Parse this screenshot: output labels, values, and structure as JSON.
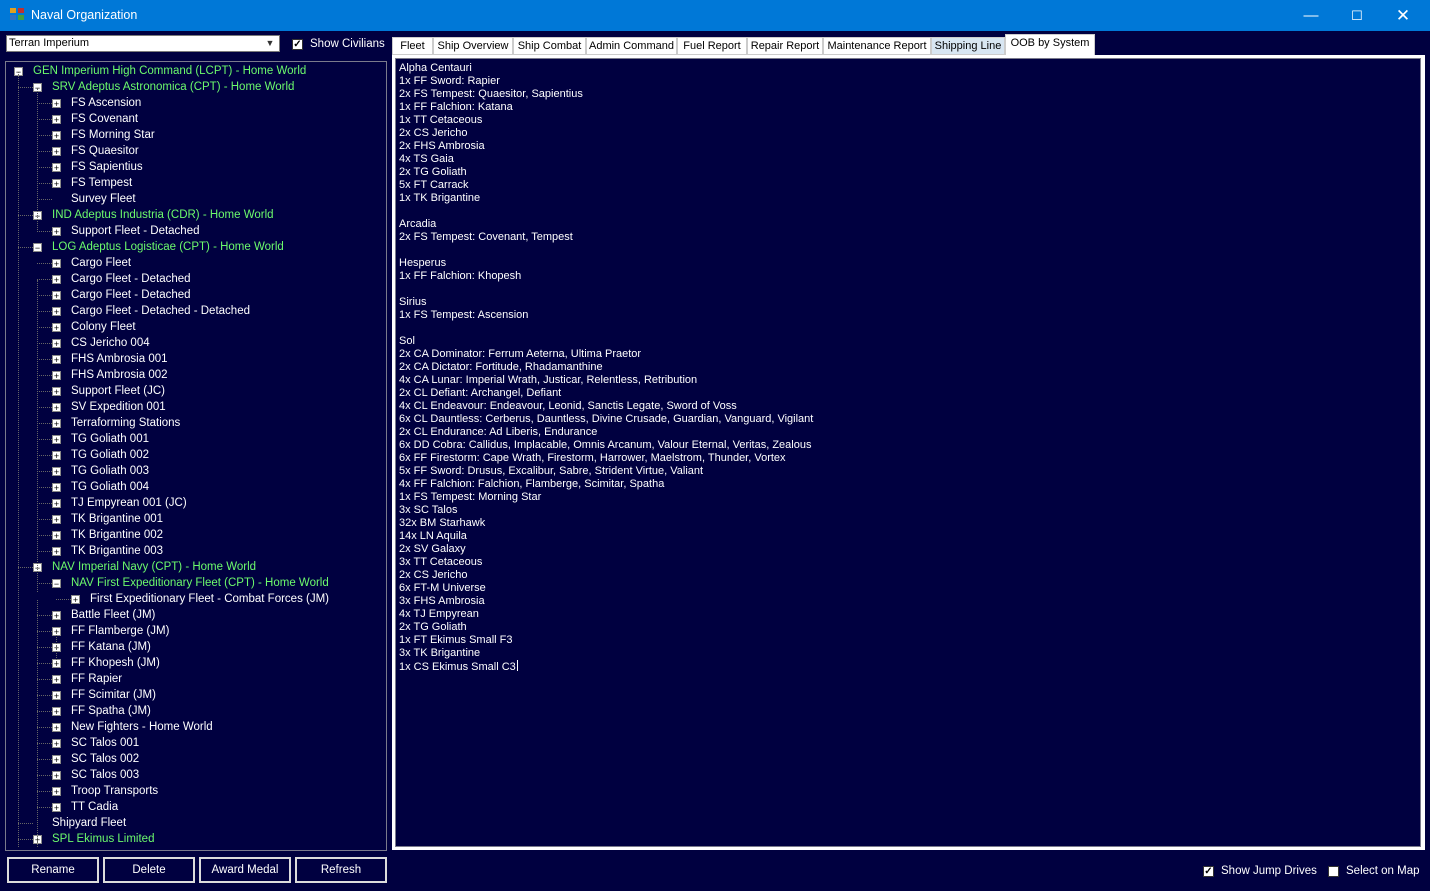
{
  "window": {
    "title": "Naval Organization",
    "minimize": "—",
    "maximize": "☐",
    "close": "✕"
  },
  "race_selector": {
    "value": "Terran Imperium",
    "arrow": "▼"
  },
  "show_civilians": {
    "label": "Show Civilians",
    "checked": true
  },
  "tree": [
    {
      "text": "GEN Imperium High Command  (LCPT)  -  Home World",
      "depth": 0,
      "color": "green",
      "exp": "minus"
    },
    {
      "text": "SRV Adeptus Astronomica  (CPT)  -  Home World",
      "depth": 1,
      "color": "green",
      "exp": "minus"
    },
    {
      "text": "FS Ascension",
      "depth": 2,
      "color": "white",
      "exp": "plus"
    },
    {
      "text": "FS Covenant",
      "depth": 2,
      "color": "white",
      "exp": "plus"
    },
    {
      "text": "FS Morning Star",
      "depth": 2,
      "color": "white",
      "exp": "plus"
    },
    {
      "text": "FS Quaesitor",
      "depth": 2,
      "color": "white",
      "exp": "plus"
    },
    {
      "text": "FS Sapientius",
      "depth": 2,
      "color": "white",
      "exp": "plus"
    },
    {
      "text": "FS Tempest",
      "depth": 2,
      "color": "white",
      "exp": "plus"
    },
    {
      "text": "Survey Fleet",
      "depth": 2,
      "color": "white",
      "exp": "none"
    },
    {
      "text": "IND Adeptus Industria  (CDR)  -  Home World",
      "depth": 1,
      "color": "green",
      "exp": "minus"
    },
    {
      "text": "Support Fleet - Detached",
      "depth": 2,
      "color": "white",
      "exp": "plus"
    },
    {
      "text": "LOG Adeptus Logisticae  (CPT)  -  Home World",
      "depth": 1,
      "color": "green",
      "exp": "minus"
    },
    {
      "text": "Cargo Fleet",
      "depth": 2,
      "color": "white",
      "exp": "plus"
    },
    {
      "text": "Cargo Fleet - Detached",
      "depth": 2,
      "color": "white",
      "exp": "plus"
    },
    {
      "text": "Cargo Fleet - Detached",
      "depth": 2,
      "color": "white",
      "exp": "plus"
    },
    {
      "text": "Cargo Fleet - Detached - Detached",
      "depth": 2,
      "color": "white",
      "exp": "plus"
    },
    {
      "text": "Colony Fleet",
      "depth": 2,
      "color": "white",
      "exp": "plus"
    },
    {
      "text": "CS Jericho 004",
      "depth": 2,
      "color": "white",
      "exp": "plus"
    },
    {
      "text": "FHS Ambrosia 001",
      "depth": 2,
      "color": "white",
      "exp": "plus"
    },
    {
      "text": "FHS Ambrosia 002",
      "depth": 2,
      "color": "white",
      "exp": "plus"
    },
    {
      "text": "Support Fleet  (JC)",
      "depth": 2,
      "color": "white",
      "exp": "plus"
    },
    {
      "text": "SV Expedition 001",
      "depth": 2,
      "color": "white",
      "exp": "plus"
    },
    {
      "text": "Terraforming Stations",
      "depth": 2,
      "color": "white",
      "exp": "plus"
    },
    {
      "text": "TG Goliath 001",
      "depth": 2,
      "color": "white",
      "exp": "plus"
    },
    {
      "text": "TG Goliath 002",
      "depth": 2,
      "color": "white",
      "exp": "plus"
    },
    {
      "text": "TG Goliath 003",
      "depth": 2,
      "color": "white",
      "exp": "plus"
    },
    {
      "text": "TG Goliath 004",
      "depth": 2,
      "color": "white",
      "exp": "plus"
    },
    {
      "text": "TJ Empyrean 001  (JC)",
      "depth": 2,
      "color": "white",
      "exp": "plus"
    },
    {
      "text": "TK Brigantine 001",
      "depth": 2,
      "color": "white",
      "exp": "plus"
    },
    {
      "text": "TK Brigantine 002",
      "depth": 2,
      "color": "white",
      "exp": "plus"
    },
    {
      "text": "TK Brigantine 003",
      "depth": 2,
      "color": "white",
      "exp": "plus"
    },
    {
      "text": "NAV Imperial Navy  (CPT)  -  Home World",
      "depth": 1,
      "color": "green",
      "exp": "minus"
    },
    {
      "text": "NAV First Expeditionary Fleet  (CPT)  -  Home World",
      "depth": 2,
      "color": "green",
      "exp": "minus"
    },
    {
      "text": "First Expeditionary Fleet - Combat Forces  (JM)",
      "depth": 3,
      "color": "white",
      "exp": "plus"
    },
    {
      "text": "Battle Fleet  (JM)",
      "depth": 2,
      "color": "white",
      "exp": "plus"
    },
    {
      "text": "FF Flamberge  (JM)",
      "depth": 2,
      "color": "white",
      "exp": "plus"
    },
    {
      "text": "FF Katana  (JM)",
      "depth": 2,
      "color": "white",
      "exp": "plus"
    },
    {
      "text": "FF Khopesh  (JM)",
      "depth": 2,
      "color": "white",
      "exp": "plus"
    },
    {
      "text": "FF Rapier",
      "depth": 2,
      "color": "white",
      "exp": "plus"
    },
    {
      "text": "FF Scimitar  (JM)",
      "depth": 2,
      "color": "white",
      "exp": "plus"
    },
    {
      "text": "FF Spatha  (JM)",
      "depth": 2,
      "color": "white",
      "exp": "plus"
    },
    {
      "text": "New Fighters - Home World",
      "depth": 2,
      "color": "white",
      "exp": "plus"
    },
    {
      "text": "SC Talos 001",
      "depth": 2,
      "color": "white",
      "exp": "plus"
    },
    {
      "text": "SC Talos 002",
      "depth": 2,
      "color": "white",
      "exp": "plus"
    },
    {
      "text": "SC Talos 003",
      "depth": 2,
      "color": "white",
      "exp": "plus"
    },
    {
      "text": "Troop Transports",
      "depth": 2,
      "color": "white",
      "exp": "plus"
    },
    {
      "text": "TT Cadia",
      "depth": 2,
      "color": "white",
      "exp": "plus"
    },
    {
      "text": "Shipyard Fleet",
      "depth": 1,
      "color": "white",
      "exp": "none"
    },
    {
      "text": "SPL Ekimus Limited",
      "depth": 1,
      "color": "green",
      "exp": "plus"
    }
  ],
  "tabs": [
    {
      "label": "Fleet",
      "state": "normal"
    },
    {
      "label": "Ship Overview",
      "state": "normal"
    },
    {
      "label": "Ship Combat",
      "state": "normal"
    },
    {
      "label": "Admin Command",
      "state": "normal"
    },
    {
      "label": "Fuel Report",
      "state": "normal"
    },
    {
      "label": "Repair Report",
      "state": "normal"
    },
    {
      "label": "Maintenance Report",
      "state": "normal"
    },
    {
      "label": "Shipping Line",
      "state": "hover"
    },
    {
      "label": "OOB by System",
      "state": "active"
    }
  ],
  "oob_lines": [
    "Alpha Centauri",
    "1x FF Sword: Rapier",
    "2x FS Tempest: Quaesitor, Sapientius",
    "1x FF Falchion: Katana",
    "1x TT Cetaceous",
    "2x CS Jericho",
    "2x FHS Ambrosia",
    "4x TS Gaia",
    "2x TG Goliath",
    "5x FT Carrack",
    "1x TK Brigantine",
    "",
    "Arcadia",
    "2x FS Tempest: Covenant, Tempest",
    "",
    "Hesperus",
    "1x FF Falchion: Khopesh",
    "",
    "Sirius",
    "1x FS Tempest: Ascension",
    "",
    "Sol",
    "2x CA Dominator: Ferrum Aeterna, Ultima Praetor",
    "2x CA Dictator: Fortitude, Rhadamanthine",
    "4x CA Lunar: Imperial Wrath, Justicar, Relentless, Retribution",
    "2x CL Defiant: Archangel, Defiant",
    "4x CL Endeavour: Endeavour, Leonid, Sanctis Legate, Sword of Voss",
    "6x CL Dauntless: Cerberus, Dauntless, Divine Crusade, Guardian, Vanguard, Vigilant",
    "2x CL Endurance: Ad Liberis, Endurance",
    "6x DD Cobra: Callidus, Implacable, Omnis Arcanum, Valour Eternal, Veritas, Zealous",
    "6x FF Firestorm: Cape Wrath, Firestorm, Harrower, Maelstrom, Thunder, Vortex",
    "5x FF Sword: Drusus, Excalibur, Sabre, Strident Virtue, Valiant",
    "4x FF Falchion: Falchion, Flamberge, Scimitar, Spatha",
    "1x FS Tempest: Morning Star",
    "3x SC Talos",
    "32x BM Starhawk",
    "14x LN Aquila",
    "2x SV Galaxy",
    "3x TT Cetaceous",
    "2x CS Jericho",
    "6x FT-M Universe",
    "3x FHS Ambrosia",
    "4x TJ Empyrean",
    "2x TG Goliath",
    "1x FT Ekimus Small F3",
    "3x TK Brigantine",
    "1x CS Ekimus Small C3"
  ],
  "buttons": [
    "Rename",
    "Delete",
    "Award Medal",
    "Refresh"
  ],
  "show_jump_drives": {
    "label": "Show Jump Drives",
    "checked": true
  },
  "select_on_map": {
    "label": "Select on Map",
    "checked": false
  },
  "colors": {
    "background": "#000040",
    "titlebar": "#0078d7",
    "tree_green": "#6cfa6c"
  }
}
